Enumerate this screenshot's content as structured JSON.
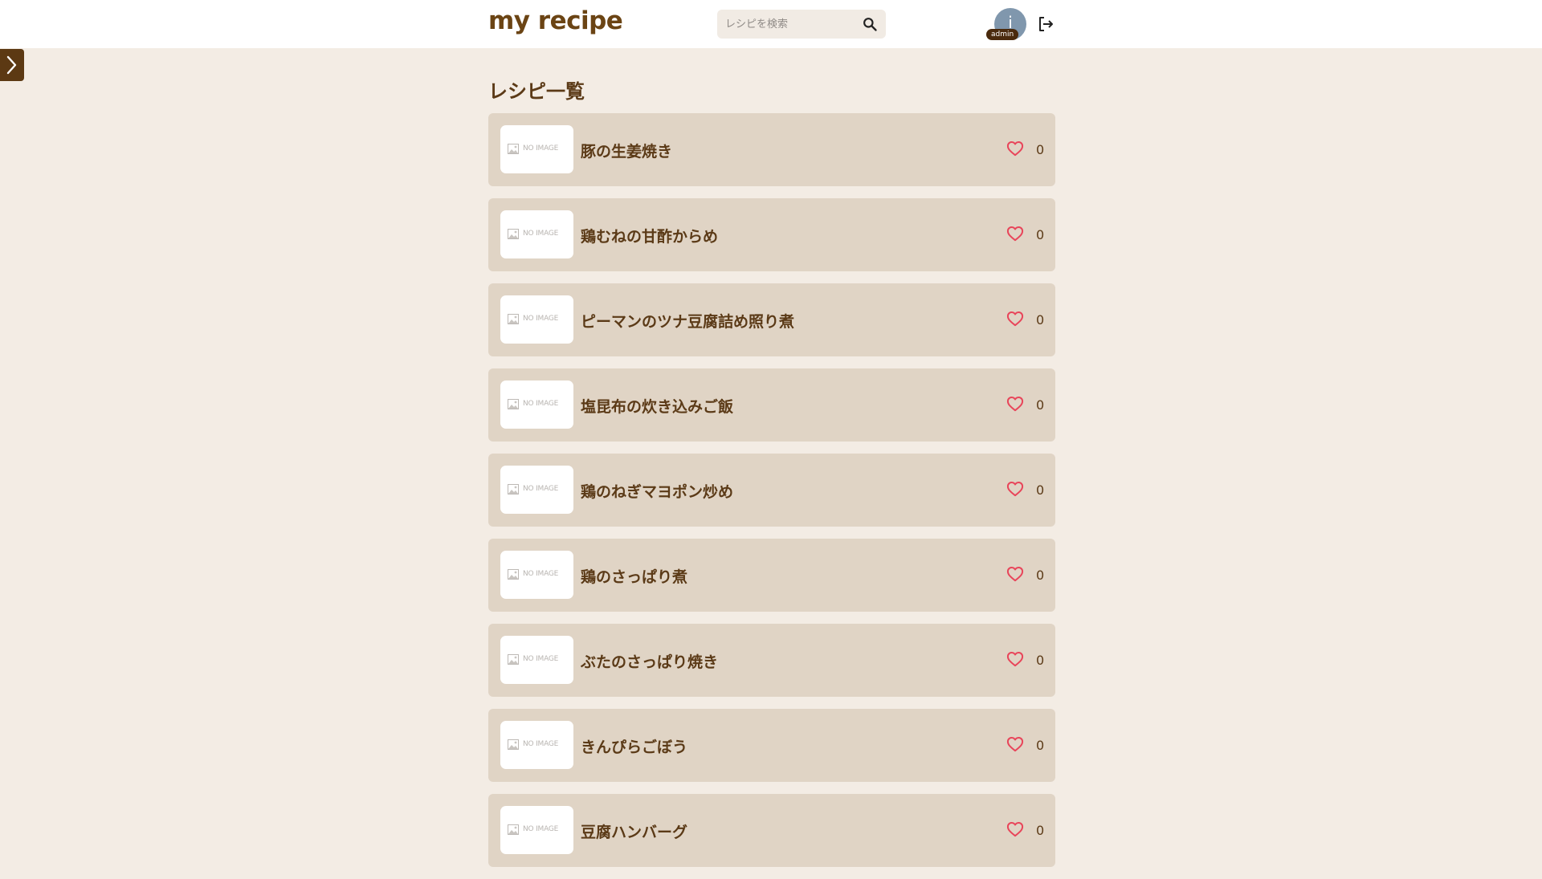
{
  "header": {
    "logo": "my recipe",
    "search": {
      "placeholder": "レシピを検索",
      "icon": "search-icon"
    },
    "user": {
      "initial": "i",
      "badge": "admin"
    },
    "logout_icon": "logout-icon"
  },
  "sidebar": {
    "toggle_icon": "chevron-right-icon"
  },
  "main": {
    "title": "レシピ一覧",
    "no_image_label": "NO IMAGE",
    "recipes": [
      {
        "title": "豚の生姜焼き",
        "likes": "0"
      },
      {
        "title": "鶏むねの甘酢からめ",
        "likes": "0"
      },
      {
        "title": "ピーマンのツナ豆腐詰め照り煮",
        "likes": "0"
      },
      {
        "title": "塩昆布の炊き込みご飯",
        "likes": "0"
      },
      {
        "title": "鶏のねぎマヨポン炒め",
        "likes": "0"
      },
      {
        "title": "鶏のさっぱり煮",
        "likes": "0"
      },
      {
        "title": "ぶたのさっぱり焼き",
        "likes": "0"
      },
      {
        "title": "きんぴらごぼう",
        "likes": "0"
      },
      {
        "title": "豆腐ハンバーグ",
        "likes": "0"
      }
    ]
  },
  "colors": {
    "background": "#f3ece4",
    "header": "#ffffff",
    "card": "#e0d4c5",
    "text": "#5b3a17",
    "heart": "#e8455a",
    "toggle": "#5c3913"
  }
}
